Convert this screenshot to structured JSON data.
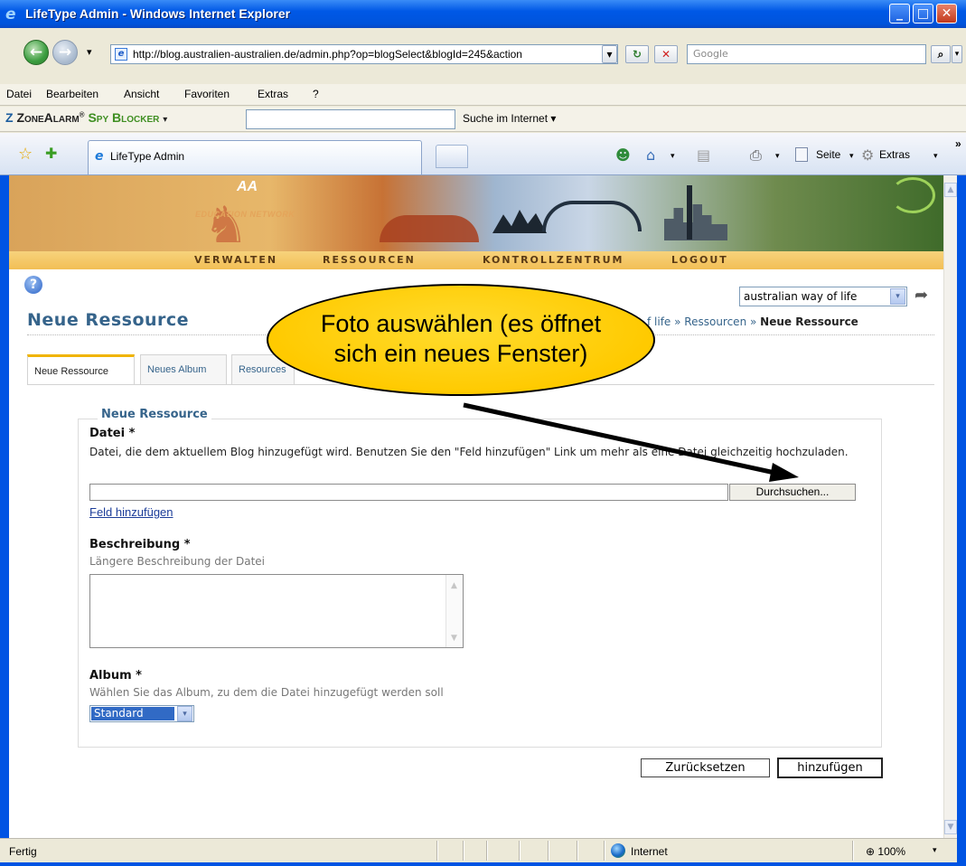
{
  "window": {
    "title": "LifeType Admin - Windows Internet Explorer",
    "minimize": "_",
    "maximize": "□",
    "close": "✕"
  },
  "addressbar": {
    "url": "http://blog.australien-australien.de/admin.php?op=blogSelect&blogId=245&action",
    "search_placeholder": "Google",
    "back": "←",
    "forward": "→",
    "dropdown": "▾",
    "refresh": "↻",
    "stop": "✕",
    "search_go": "⌕"
  },
  "menu": [
    "Datei",
    "Bearbeiten",
    "Ansicht",
    "Favoriten",
    "Extras",
    "?"
  ],
  "zonealarm": {
    "logo_z": "Z",
    "logo_zone": "ZoneAlarm",
    "logo_reg": "®",
    "logo_spy": " Spy Blocker",
    "search_label": "Suche im Internet ▾",
    "dropdown": "▾"
  },
  "browser_tabs": {
    "active_label": "LifeType Admin",
    "star": "☆",
    "add_fav": "✚"
  },
  "toolbar": {
    "home": "⌂",
    "feeds": "▤",
    "print": "⎙",
    "page_label": "Seite",
    "extras_label": "Extras",
    "more": "»",
    "caret": "▾",
    "messenger": "☻",
    "gear": "⚙"
  },
  "banner": {
    "badge": "AA",
    "network": "EDUCATION NETWORK",
    "roo": "♞"
  },
  "nav": [
    "VERWALTEN",
    "RESSOURCEN",
    "KONTROLLZENTRUM",
    "LOGOUT"
  ],
  "help_icon": "?",
  "blog_select": {
    "value": "australian way of life",
    "arrow": "▾",
    "go": "➦"
  },
  "page": {
    "title": "Neue Ressource",
    "breadcrumb_prefix": "f life » Ressourcen » ",
    "breadcrumb_current": "Neue Ressource"
  },
  "tabs": [
    "Neue Ressource",
    "Neues Album",
    "Resources"
  ],
  "form": {
    "legend": "Neue Ressource",
    "file_label": "Datei *",
    "file_desc": "Datei, die dem aktuellem Blog hinzugefügt wird. Benutzen Sie den \"Feld hinzufügen\" Link um mehr als eine Datei gleichzeitig hochzuladen.",
    "browse": "Durchsuchen...",
    "add_field": "Feld hinzufügen",
    "desc_label": "Beschreibung *",
    "desc_hint": "Längere Beschreibung der Datei",
    "album_label": "Album *",
    "album_hint": "Wählen Sie das Album, zu dem die Datei hinzugefügt werden soll",
    "album_value": "Standard",
    "reset": "Zurücksetzen",
    "submit": "hinzufügen"
  },
  "callout": {
    "line1": "Foto auswählen (es öffnet",
    "line2": "sich ein neues Fenster)"
  },
  "status": {
    "text": "Fertig",
    "zone": "Internet",
    "zoom": "⊕ 100%",
    "zoom_caret": "▾"
  },
  "scroll": {
    "up": "▲",
    "down": "▼"
  }
}
